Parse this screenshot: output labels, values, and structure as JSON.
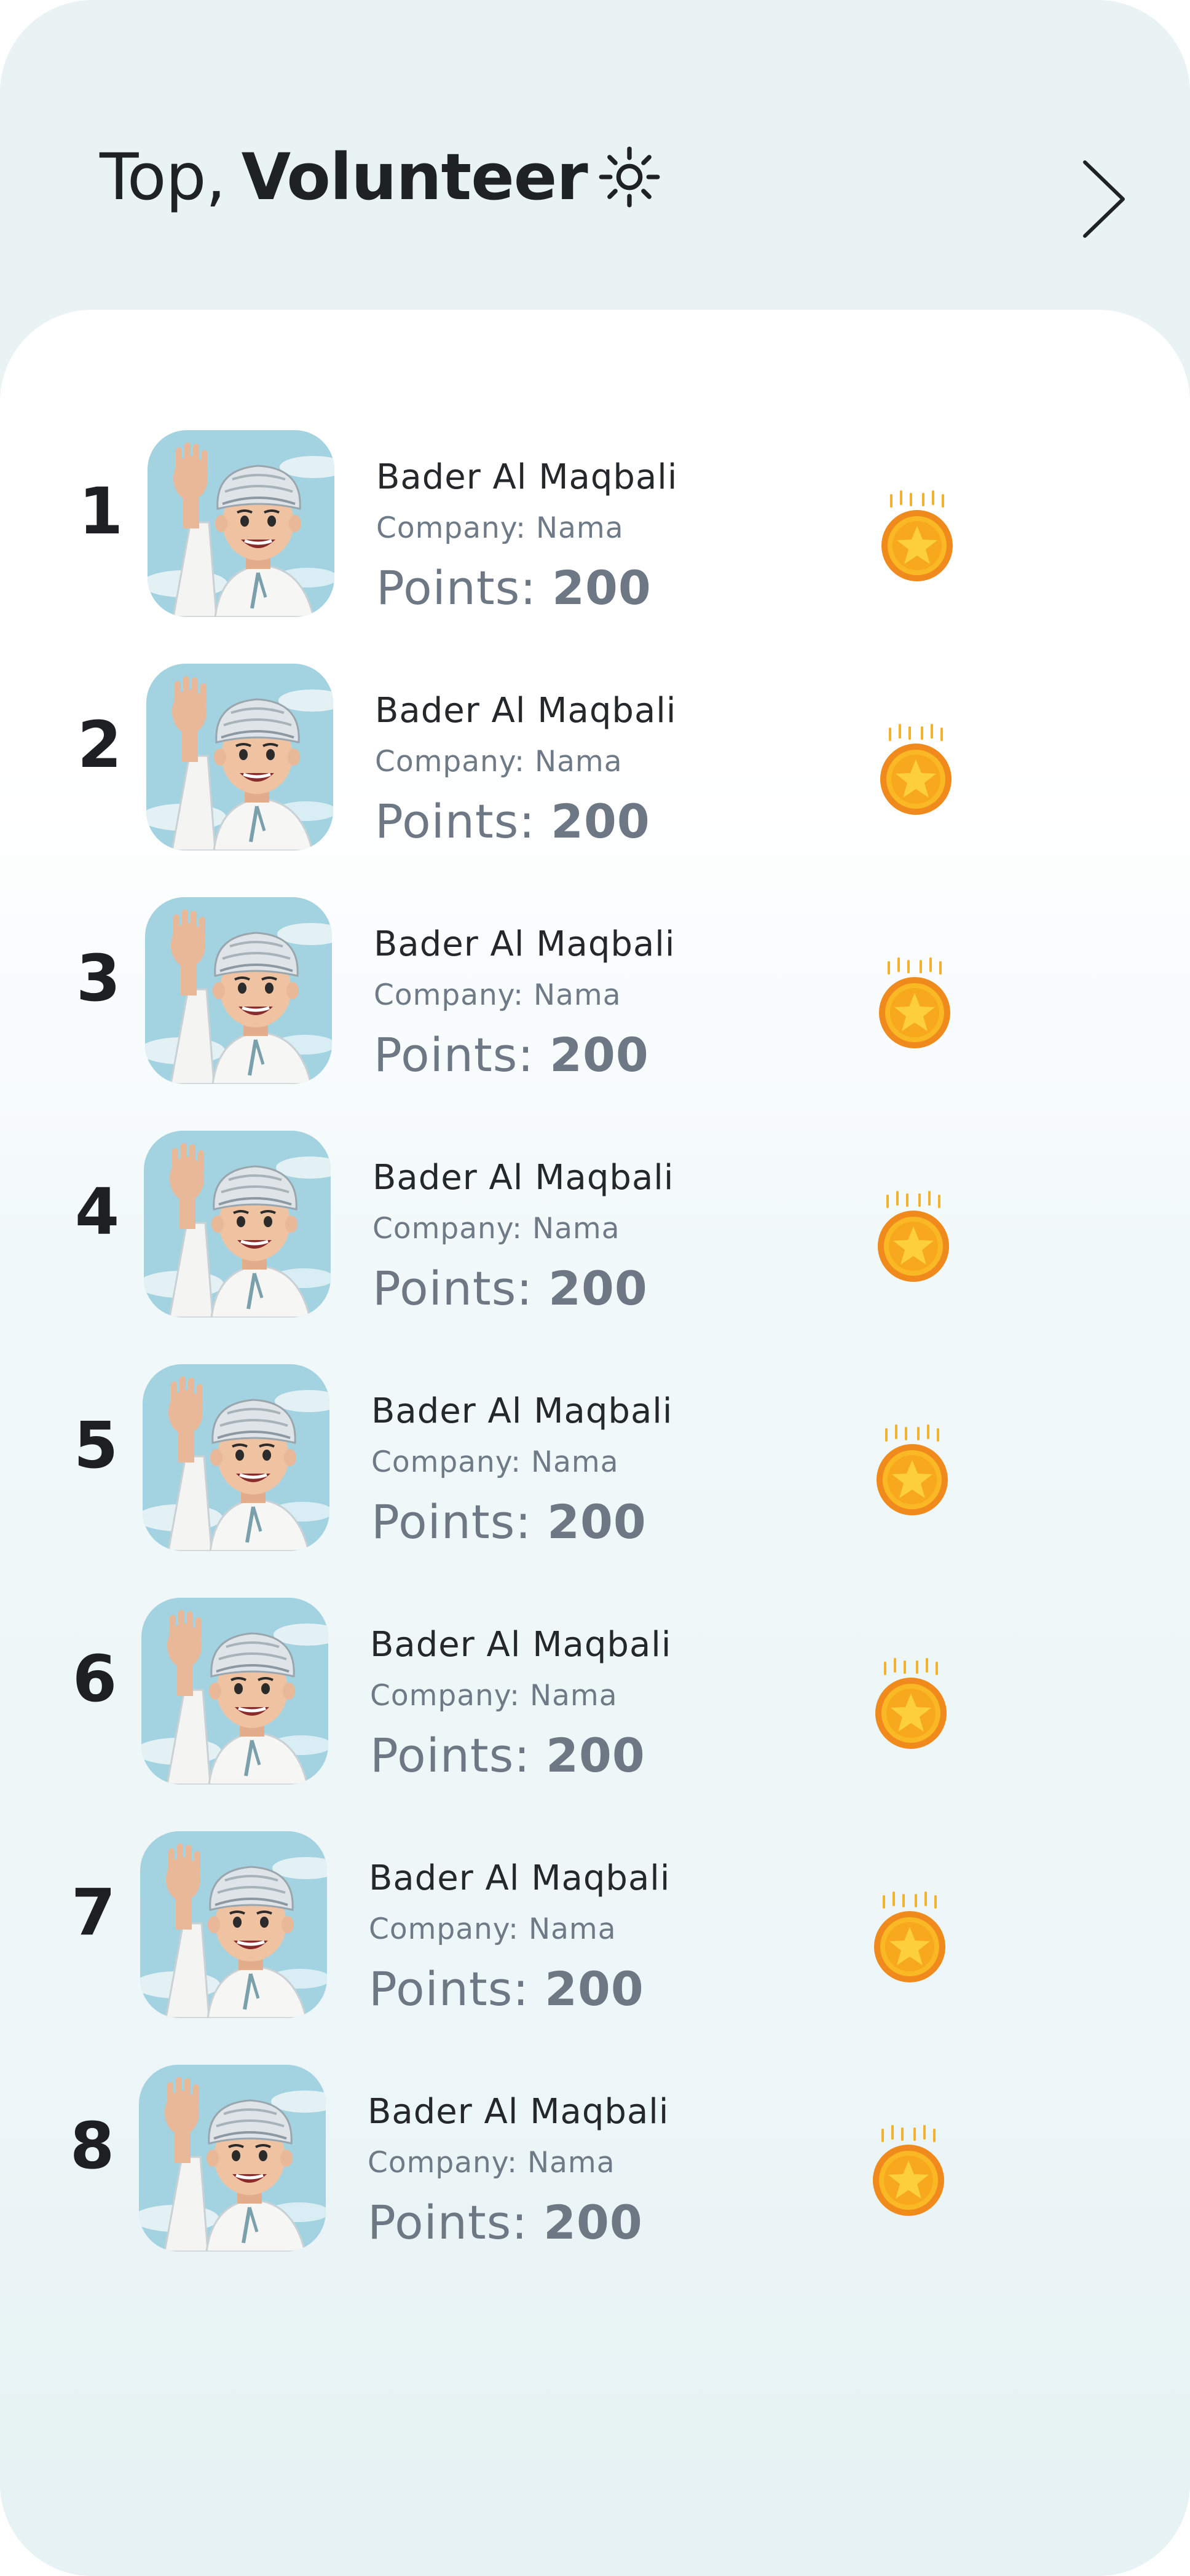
{
  "header": {
    "title_light": "Top,",
    "title_bold": "Volunteer",
    "title_icon": "sun-icon",
    "next_icon": "chevron-right-icon"
  },
  "colors": {
    "background": "#eaf3f4",
    "text_dark": "#1f2225",
    "text_muted": "#6e7a85",
    "coin_gold": "#f7b21d",
    "coin_ring": "#f08a1c",
    "avatar_sky": "#9fd0df"
  },
  "points_label": "Points:",
  "volunteers": [
    {
      "rank": "1",
      "name": "Bader Al Maqbali",
      "company": "Company: Nama",
      "points": "200",
      "badge": "coin-star-icon"
    },
    {
      "rank": "2",
      "name": "Bader Al Maqbali",
      "company": "Company: Nama",
      "points": "200",
      "badge": "coin-star-icon"
    },
    {
      "rank": "3",
      "name": "Bader Al Maqbali",
      "company": "Company: Nama",
      "points": "200",
      "badge": "coin-star-icon"
    },
    {
      "rank": "4",
      "name": "Bader Al Maqbali",
      "company": "Company: Nama",
      "points": "200",
      "badge": "coin-star-icon"
    },
    {
      "rank": "5",
      "name": "Bader Al Maqbali",
      "company": "Company: Nama",
      "points": "200",
      "badge": "coin-star-icon"
    },
    {
      "rank": "6",
      "name": "Bader Al Maqbali",
      "company": "Company: Nama",
      "points": "200",
      "badge": "coin-star-icon"
    },
    {
      "rank": "7",
      "name": "Bader Al Maqbali",
      "company": "Company: Nama",
      "points": "200",
      "badge": "coin-star-icon"
    },
    {
      "rank": "8",
      "name": "Bader Al Maqbali",
      "company": "Company: Nama",
      "points": "200",
      "badge": "coin-star-icon"
    }
  ]
}
